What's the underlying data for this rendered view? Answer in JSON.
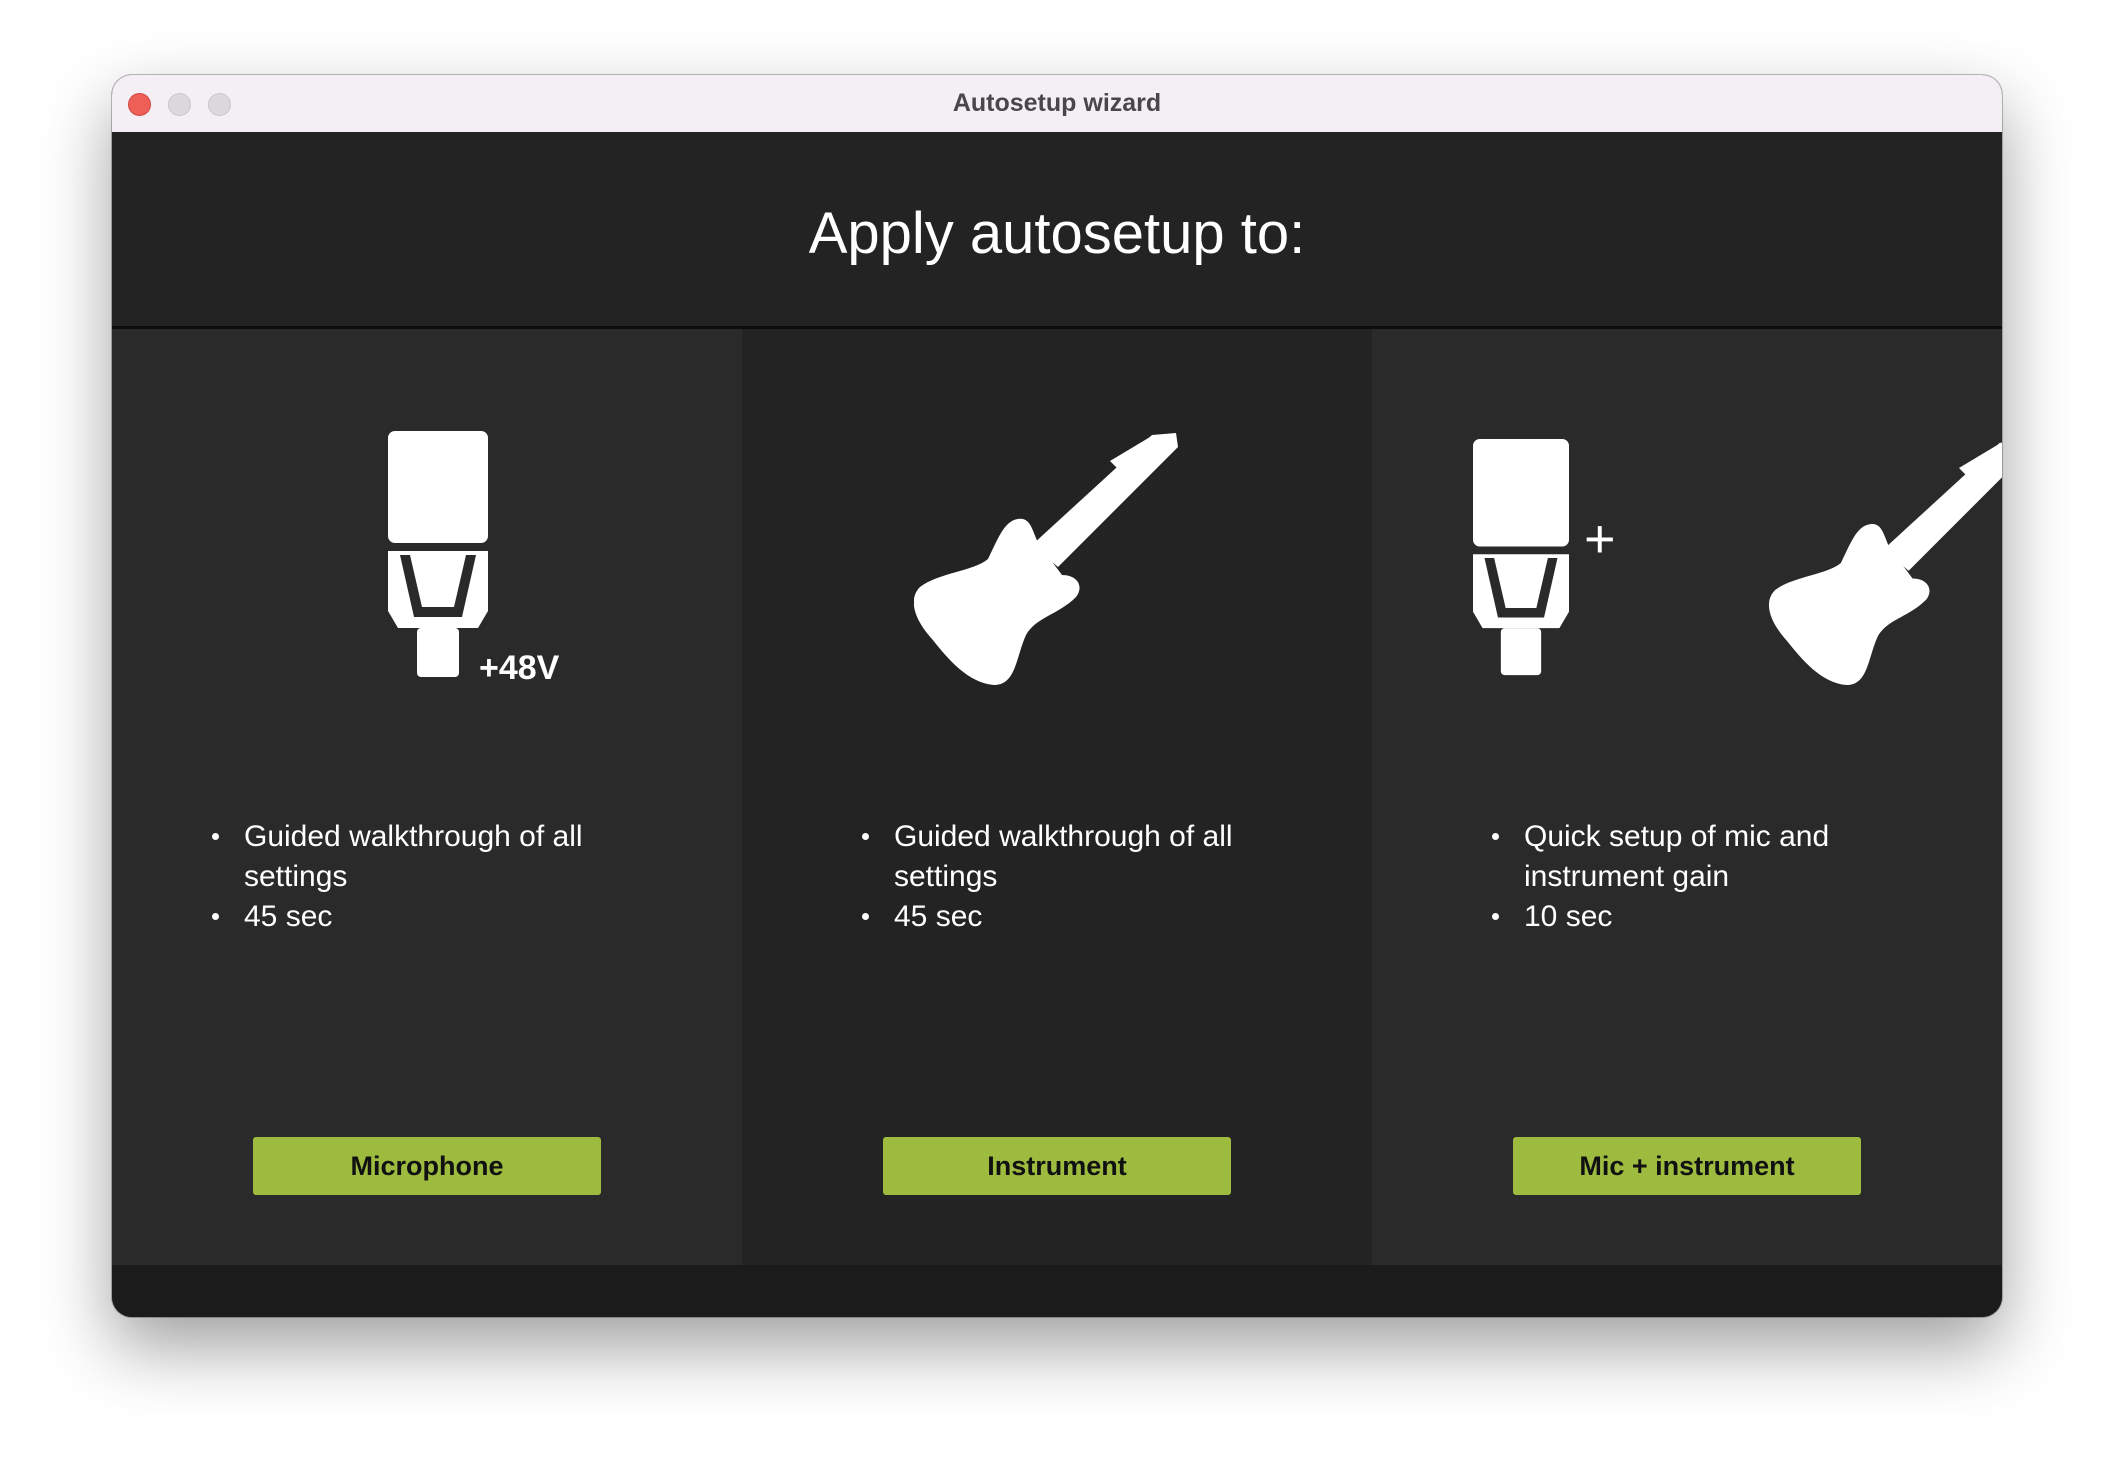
{
  "window": {
    "title": "Autosetup wizard"
  },
  "header": {
    "heading": "Apply autosetup to:"
  },
  "options": [
    {
      "icon": "microphone-48v-icon",
      "phantom_label": "+48V",
      "bullets": [
        "Guided walkthrough of all settings",
        "45 sec"
      ],
      "button_label": "Microphone"
    },
    {
      "icon": "guitar-icon",
      "bullets": [
        "Guided walkthrough of all settings",
        "45 sec"
      ],
      "button_label": "Instrument"
    },
    {
      "icon": "mic-plus-guitar-icon",
      "plus_symbol": "+",
      "bullets": [
        "Quick setup of mic and instrument gain",
        "10 sec"
      ],
      "button_label": "Mic + instrument"
    }
  ],
  "colors": {
    "accent_button": "#9dbb3f",
    "panel_light": "#2a2a2a",
    "panel_dark": "#232323",
    "close_button": "#ee5f57"
  }
}
